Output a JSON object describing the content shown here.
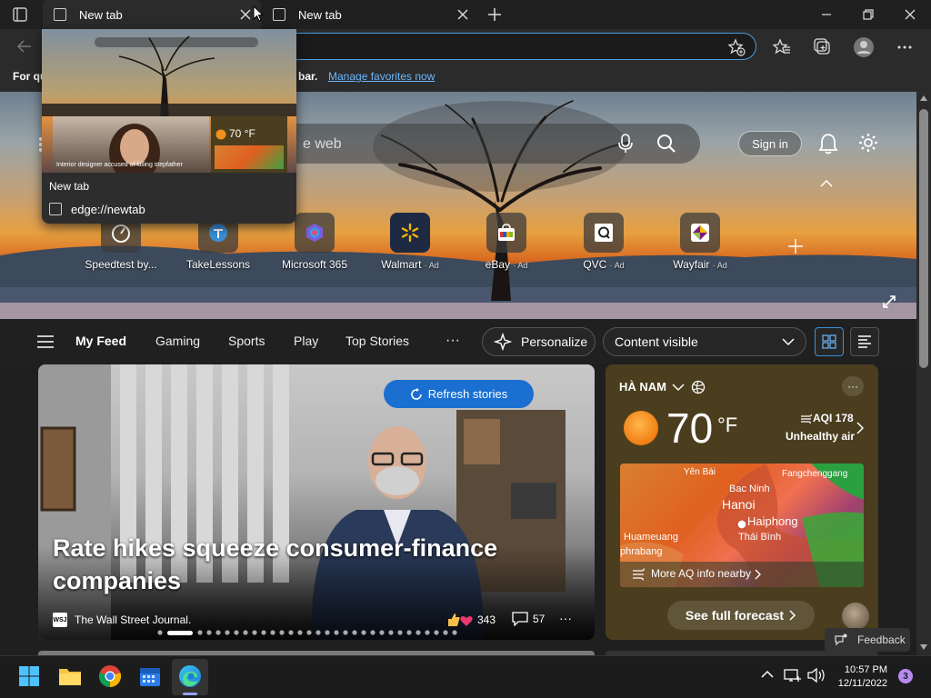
{
  "tabs": [
    {
      "title": "New tab",
      "active": true
    },
    {
      "title": "New tab",
      "active": false
    }
  ],
  "tab_preview": {
    "title": "New tab",
    "url": "edge://newtab",
    "thumb_story": "Interior designer accused of killing stepfather",
    "thumb_temp": "70 °F"
  },
  "favorites_bar": {
    "text": "For qu",
    "text_tail": "bar.",
    "link": "Manage favorites now"
  },
  "hero": {
    "search_placeholder": "e web",
    "signin_label": "Sign in"
  },
  "quick_links": [
    {
      "label": "Speedtest by...",
      "ad": "",
      "icon": "speedtest-icon"
    },
    {
      "label": "TakeLessons",
      "ad": "",
      "icon": "takelessons-icon"
    },
    {
      "label": "Microsoft 365",
      "ad": "",
      "icon": "microsoft365-icon"
    },
    {
      "label": "Walmart",
      "ad": "· Ad",
      "icon": "walmart-icon"
    },
    {
      "label": "eBay",
      "ad": "· Ad",
      "icon": "ebay-icon"
    },
    {
      "label": "QVC",
      "ad": "· Ad",
      "icon": "qvc-icon"
    },
    {
      "label": "Wayfair",
      "ad": "· Ad",
      "icon": "wayfair-icon"
    }
  ],
  "feed_nav": {
    "items": [
      "My Feed",
      "Gaming",
      "Sports",
      "Play",
      "Top Stories"
    ],
    "more": "···",
    "personalize": "Personalize",
    "content_visible": "Content visible"
  },
  "main_story": {
    "refresh_label": "Refresh stories",
    "headline": "Rate hikes squeeze consumer-finance companies",
    "source": "The Wall Street Journal.",
    "source_badge": "WSJ",
    "reactions": "343",
    "comments": "57",
    "more": "···"
  },
  "weather": {
    "location": "HÀ NAM",
    "temp": "70",
    "unit": "°F",
    "aqi": "AQI 178",
    "aqi_status": "Unhealthy air",
    "map_labels": [
      "Yên Bái",
      "Fangchenggang",
      "Bac Ninh",
      "Hanoi",
      "Haiphong",
      "Huameuang",
      "Thái Bình",
      "phrabang"
    ],
    "aq_link": "More AQ info nearby",
    "forecast_btn": "See full forecast",
    "more": "···"
  },
  "feedback_label": "Feedback",
  "taskbar": {
    "time": "10:57 PM",
    "date": "12/11/2022",
    "notifications": "3"
  }
}
